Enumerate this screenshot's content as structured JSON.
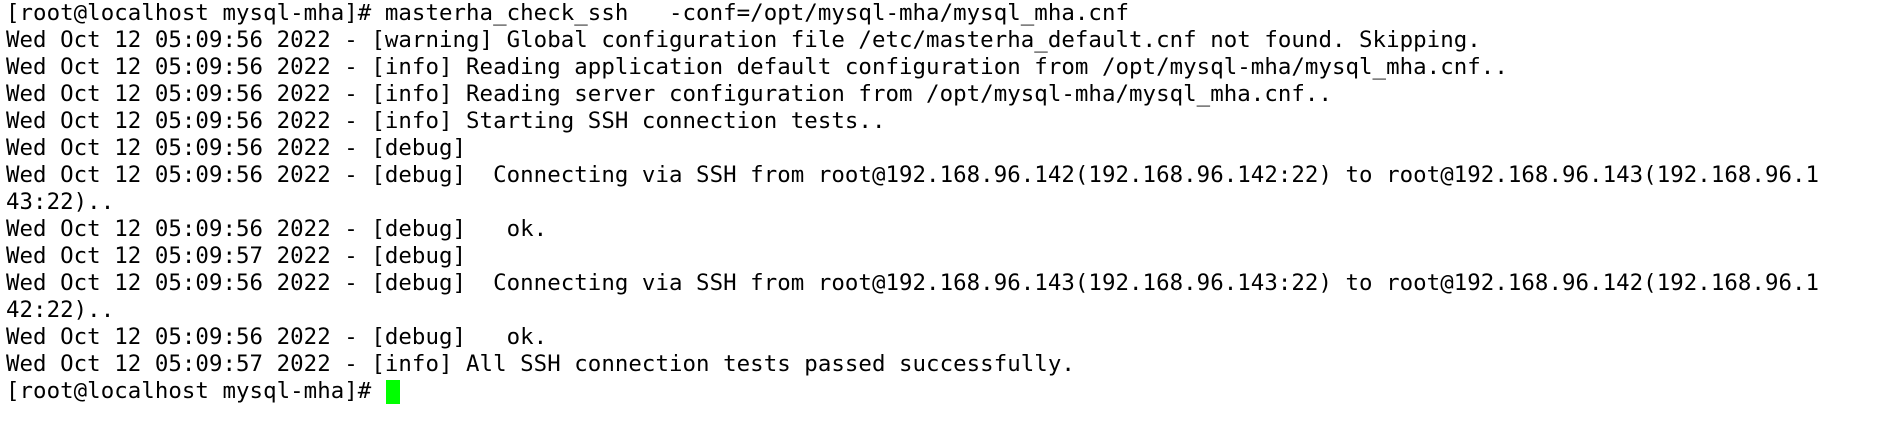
{
  "terminal": {
    "background_color": "#ffffff",
    "text_color": "#000000",
    "cursor_color": "#00ff00",
    "lines": [
      "[root@localhost mysql-mha]# masterha_check_ssh   -conf=/opt/mysql-mha/mysql_mha.cnf",
      "Wed Oct 12 05:09:56 2022 - [warning] Global configuration file /etc/masterha_default.cnf not found. Skipping.",
      "Wed Oct 12 05:09:56 2022 - [info] Reading application default configuration from /opt/mysql-mha/mysql_mha.cnf..",
      "Wed Oct 12 05:09:56 2022 - [info] Reading server configuration from /opt/mysql-mha/mysql_mha.cnf..",
      "Wed Oct 12 05:09:56 2022 - [info] Starting SSH connection tests..",
      "Wed Oct 12 05:09:56 2022 - [debug]",
      "Wed Oct 12 05:09:56 2022 - [debug]  Connecting via SSH from root@192.168.96.142(192.168.96.142:22) to root@192.168.96.143(192.168.96.1",
      "43:22)..",
      "Wed Oct 12 05:09:56 2022 - [debug]   ok.",
      "Wed Oct 12 05:09:57 2022 - [debug]",
      "Wed Oct 12 05:09:56 2022 - [debug]  Connecting via SSH from root@192.168.96.143(192.168.96.143:22) to root@192.168.96.142(192.168.96.1",
      "42:22)..",
      "Wed Oct 12 05:09:56 2022 - [debug]   ok.",
      "Wed Oct 12 05:09:57 2022 - [info] All SSH connection tests passed successfully."
    ],
    "prompt": "[root@localhost mysql-mha]# "
  }
}
